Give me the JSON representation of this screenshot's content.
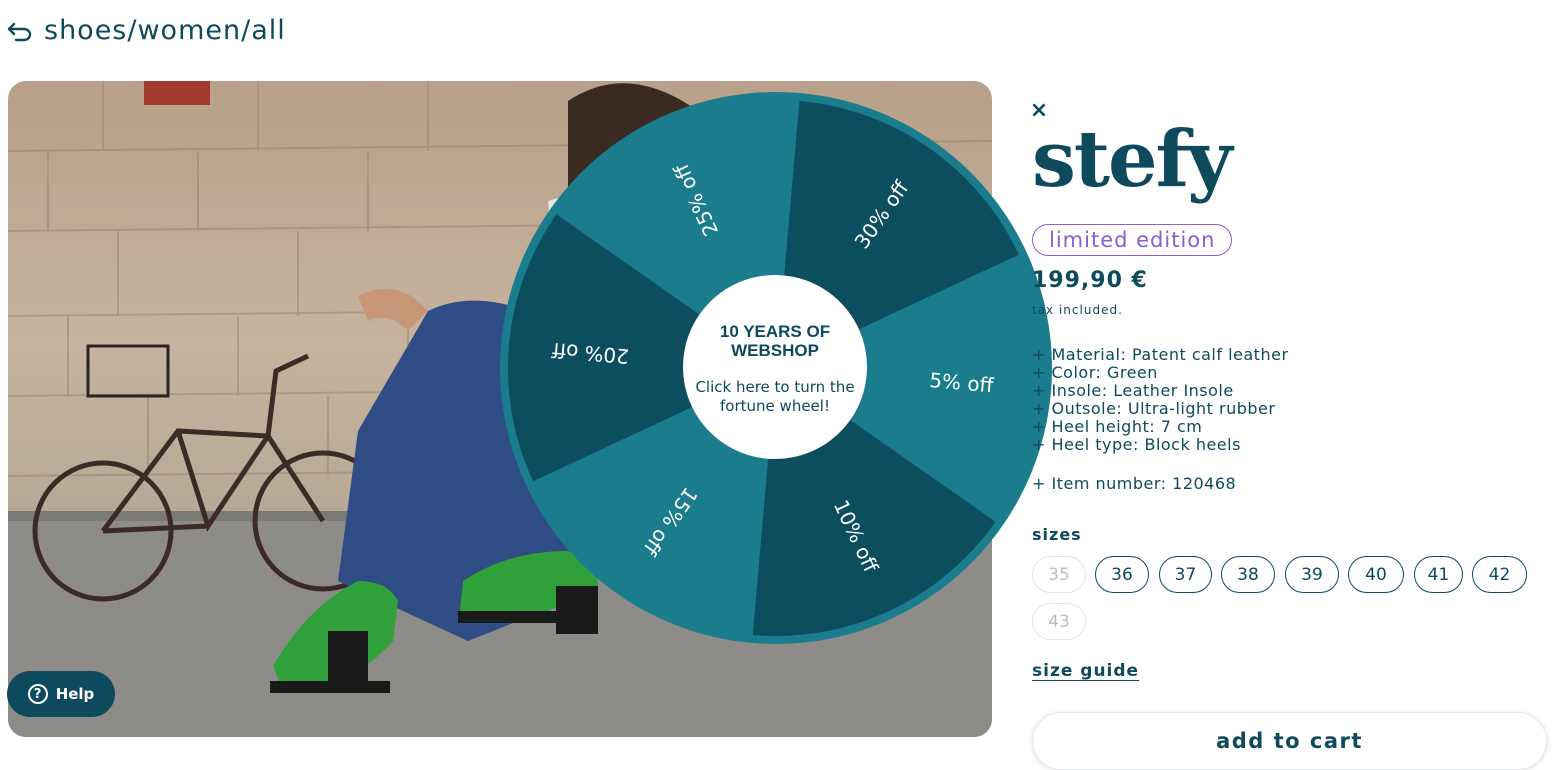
{
  "breadcrumb": {
    "path": "shoes/women/all",
    "back_icon": "back-arrow-icon"
  },
  "help": {
    "label": "Help",
    "icon_glyph": "?"
  },
  "wheel": {
    "title": "10 YEARS OF WEBSHOP",
    "cta": "Click here to turn the fortune wheel!",
    "segments": [
      {
        "label": "30% off",
        "color": "#0d4e5e"
      },
      {
        "label": "5% off",
        "color": "#1b7c8e"
      },
      {
        "label": "10% off",
        "color": "#0d4e5e"
      },
      {
        "label": "15% off",
        "color": "#1b7c8e"
      },
      {
        "label": "20% off",
        "color": "#0d4e5e"
      },
      {
        "label": "25% off",
        "color": "#1b7c8e"
      }
    ]
  },
  "product": {
    "close_glyph": "×",
    "title": "stefy",
    "badge": "limited edition",
    "price": "199,90 €",
    "tax_note": "tax included.",
    "features": [
      "+ Material: Patent calf leather",
      "+ Color: Green",
      "+ Insole: Leather Insole",
      "+ Outsole: Ultra-light rubber",
      "+ Heel height: 7 cm",
      "+ Heel type: Block heels"
    ],
    "item_number": "+ Item number: 120468",
    "sizes_label": "sizes",
    "sizes": [
      {
        "label": "35",
        "available": false
      },
      {
        "label": "36",
        "available": true
      },
      {
        "label": "37",
        "available": true
      },
      {
        "label": "38",
        "available": true
      },
      {
        "label": "39",
        "available": true
      },
      {
        "label": "40",
        "available": true
      },
      {
        "label": "41",
        "available": true
      },
      {
        "label": "42",
        "available": true
      },
      {
        "label": "43",
        "available": false
      }
    ],
    "size_guide": "size guide",
    "add_to_cart": "add to cart"
  },
  "colors": {
    "brand": "#0e4a5c",
    "badge": "#8a5ed0",
    "disabled": "#b5c0c4"
  }
}
